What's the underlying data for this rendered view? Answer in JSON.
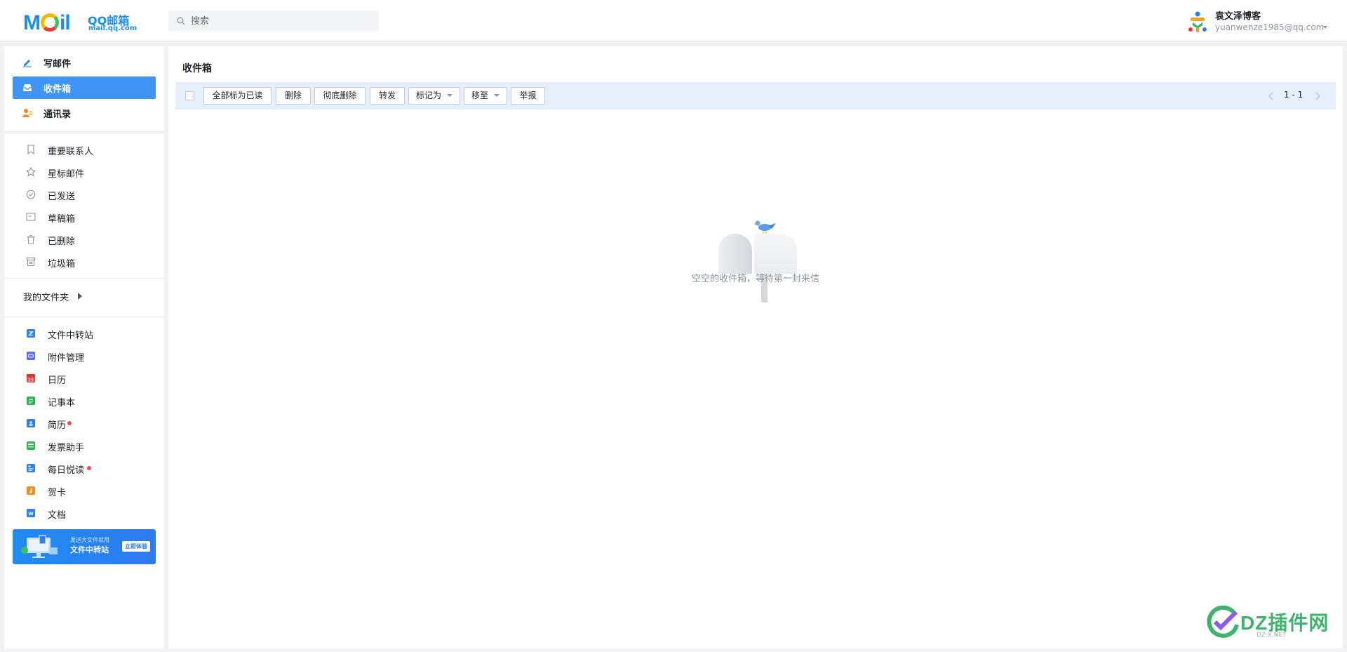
{
  "header": {
    "logo_main": "Mail",
    "logo_brand": "QQ邮箱",
    "logo_url": "mail.qq.com",
    "search_placeholder": "搜索",
    "user_name": "袁文泽博客",
    "user_email": "yuanwenze1985@qq.com"
  },
  "sidebar": {
    "primary": [
      {
        "label": "写邮件",
        "icon": "pen-icon",
        "active": false
      },
      {
        "label": "收件箱",
        "icon": "inbox-icon",
        "active": true
      },
      {
        "label": "通讯录",
        "icon": "contacts-icon",
        "active": false
      }
    ],
    "folders": [
      {
        "label": "重要联系人",
        "icon": "bookmark-icon"
      },
      {
        "label": "星标邮件",
        "icon": "star-icon"
      },
      {
        "label": "已发送",
        "icon": "check-circle-icon"
      },
      {
        "label": "草稿箱",
        "icon": "draft-icon"
      },
      {
        "label": "已删除",
        "icon": "trash-icon"
      },
      {
        "label": "垃圾箱",
        "icon": "spam-icon"
      }
    ],
    "my_folders_label": "我的文件夹",
    "apps": [
      {
        "label": "文件中转站",
        "icon": "file-transfer-icon",
        "color": "#2f7ff0",
        "dot": false
      },
      {
        "label": "附件管理",
        "icon": "attachment-icon",
        "color": "#5b6ef5",
        "dot": false
      },
      {
        "label": "日历",
        "icon": "calendar-icon",
        "color": "#f04a4a",
        "dot": false
      },
      {
        "label": "记事本",
        "icon": "notebook-icon",
        "color": "#2fb34f",
        "dot": false
      },
      {
        "label": "简历",
        "icon": "resume-icon",
        "color": "#2f7ff0",
        "dot": true
      },
      {
        "label": "发票助手",
        "icon": "invoice-icon",
        "color": "#2fb34f",
        "dot": false
      },
      {
        "label": "每日悦读",
        "icon": "reading-icon",
        "color": "#2f7ff0",
        "dot": true
      },
      {
        "label": "贺卡",
        "icon": "greeting-card-icon",
        "color": "#f58a1f",
        "dot": false
      },
      {
        "label": "文档",
        "icon": "document-icon",
        "color": "#2f7ff0",
        "dot": false
      }
    ],
    "banner": {
      "small": "发送大文件就用",
      "big": "文件中转站",
      "button": "立即体验"
    }
  },
  "main": {
    "title": "收件箱",
    "toolbar": {
      "mark_all_read": "全部标为已读",
      "delete": "删除",
      "delete_permanently": "彻底删除",
      "forward": "转发",
      "mark_as": "标记为",
      "move_to": "移至",
      "report": "举报"
    },
    "pager": "1 - 1",
    "empty_text": "空空的收件箱，等待第一封来信"
  },
  "watermark": {
    "text": "DZ插件网",
    "sub": "DZ-X.NET"
  },
  "colors": {
    "accent": "#3f95f6",
    "toolbar_bg": "#e5eefb",
    "page_bg": "#f0f2f5"
  }
}
